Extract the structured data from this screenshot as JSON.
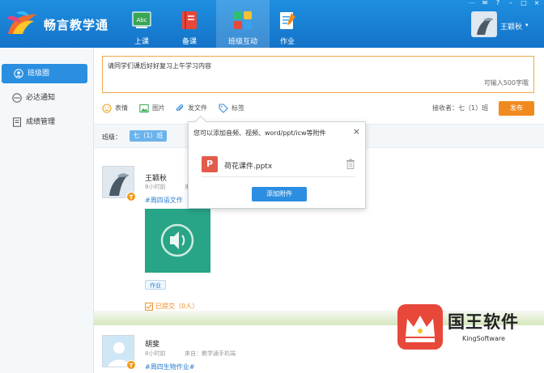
{
  "app": {
    "name": "畅言教学通"
  },
  "window_controls": [
    "⋯",
    "✉",
    "?",
    "–",
    "□",
    "×"
  ],
  "nav": {
    "tabs": [
      {
        "label": "上课",
        "icon": "abc-board-icon"
      },
      {
        "label": "备课",
        "icon": "book-icon"
      },
      {
        "label": "班级互动",
        "icon": "interaction-grid-icon",
        "active": true
      },
      {
        "label": "作业",
        "icon": "homework-pencil-icon"
      }
    ]
  },
  "user": {
    "name": "王颖秋",
    "avatar": "user-avatar"
  },
  "sidebar": {
    "items": [
      {
        "label": "班级圈",
        "icon": "user-circle-icon",
        "active": true
      },
      {
        "label": "必达通知",
        "icon": "notice-icon"
      },
      {
        "label": "成绩管理",
        "icon": "grade-book-icon"
      }
    ]
  },
  "compose": {
    "text": "请同学们课后好好复习上午学习内容",
    "counter": "可输入500字哦",
    "tools": [
      {
        "label": "表情",
        "icon": "emoji-icon"
      },
      {
        "label": "图片",
        "icon": "image-icon"
      },
      {
        "label": "发文件",
        "icon": "paperclip-icon"
      },
      {
        "label": "标签",
        "icon": "tag-icon"
      }
    ],
    "receiver": "接收者：七（1）班",
    "publish_label": "发布"
  },
  "class_filter": {
    "label": "班级：",
    "selected": "七（1）班"
  },
  "posts": [
    {
      "name": "王颖秋",
      "time": "8小时前",
      "source_partial": "来",
      "tag": "#周四语文作",
      "media_icon": "audio-speaker-icon",
      "chip": "作业",
      "submit": "已提交（0人）",
      "badge": "T"
    },
    {
      "name": "胡斐",
      "time": "8小时前",
      "source": "来自：教学通手机端",
      "tag": "#周四生物作业#",
      "badge": "T"
    }
  ],
  "popup": {
    "title": "您可以添加音频、视频、word/ppt/icw等附件",
    "close": "×",
    "file_name": "荷花课件.pptx",
    "file_icon_letter": "P",
    "add_label": "添加附件"
  },
  "watermark": {
    "title": "国王软件",
    "subtitle": "KingSoftware"
  },
  "colors": {
    "header": "#1a84d8",
    "accent_orange": "#f18a1e",
    "active_blue": "#2a8fe0",
    "media_green": "#28a586",
    "ppt_red": "#e35b4c"
  }
}
